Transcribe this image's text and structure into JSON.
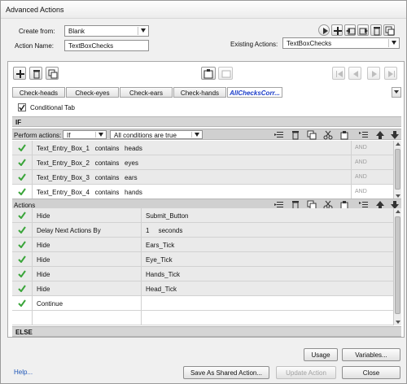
{
  "window": {
    "title": "Advanced Actions"
  },
  "form": {
    "create_from_label": "Create from:",
    "create_from_value": "Blank",
    "action_name_label": "Action Name:",
    "action_name_value": "TextBoxChecks",
    "existing_actions_label": "Existing Actions:",
    "existing_actions_value": "TextBoxChecks"
  },
  "tabs": [
    "Check-heads",
    "Check-eyes",
    "Check-ears",
    "Check-hands",
    "AllChecksCorr..."
  ],
  "conditional_tab_label": "Conditional Tab",
  "if_label": "IF",
  "perform_actions": {
    "label": "Perform actions:",
    "mode": "If",
    "condition": "All conditions are true"
  },
  "conditions": [
    {
      "text": "Text_Entry_Box_1   contains   heads",
      "op": "AND"
    },
    {
      "text": "Text_Entry_Box_2   contains   eyes",
      "op": "AND"
    },
    {
      "text": "Text_Entry_Box_3   contains   ears",
      "op": "AND"
    },
    {
      "text": "Text_Entry_Box_4   contains   hands",
      "op": "AND"
    }
  ],
  "actions_label": "Actions",
  "actions": [
    {
      "action": "Hide",
      "target": "Submit_Button"
    },
    {
      "action": "Delay Next Actions By",
      "target": "1     seconds"
    },
    {
      "action": "Hide",
      "target": "Ears_Tick"
    },
    {
      "action": "Hide",
      "target": "Eye_Tick"
    },
    {
      "action": "Hide",
      "target": "Hands_Tick"
    },
    {
      "action": "Hide",
      "target": "Head_Tick"
    },
    {
      "action": "Continue",
      "target": ""
    }
  ],
  "else_label": "ELSE",
  "buttons": {
    "usage": "Usage",
    "variables": "Variables...",
    "help": "Help...",
    "save_shared": "Save As Shared Action...",
    "update": "Update Action",
    "close": "Close"
  },
  "colors": {
    "check_green": "#3aa53a",
    "active_tab_text": "#1a3cc8",
    "link": "#1e56b8"
  }
}
